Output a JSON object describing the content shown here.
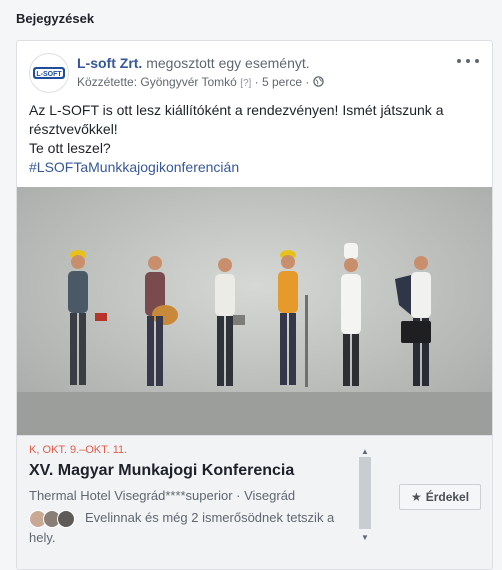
{
  "section": {
    "title": "Bejegyzések"
  },
  "post": {
    "author": "L-soft Zrt.",
    "action": " megosztott egy eseményt.",
    "meta_prefix": "Közzétette: Gyöngyvér Tomkó",
    "meta_question": "[?]",
    "meta_time": "· 5 perce ·",
    "lines": [
      "Az L-SOFT is ott lesz kiállítóként a rendezvényen! Ismét játszunk a résztvevőkkel!",
      "Te ott leszel?"
    ],
    "hashtag": "#LSOFTaMunkkajogikonferencián",
    "logo_text": "L-SOFT"
  },
  "event": {
    "date": "K, OKT. 9.–OKT. 11.",
    "title": "XV. Magyar Munkajogi Konferencia",
    "location": "Thermal Hotel Visegrád****superior · Visegrád",
    "friends_text": "Evelinnak és még 2 ismerősödnek tetszik a hely.",
    "interested_label": "Érdekel",
    "interested_icon": "★"
  },
  "colors": {
    "link": "#365899",
    "date": "#e45b49"
  }
}
